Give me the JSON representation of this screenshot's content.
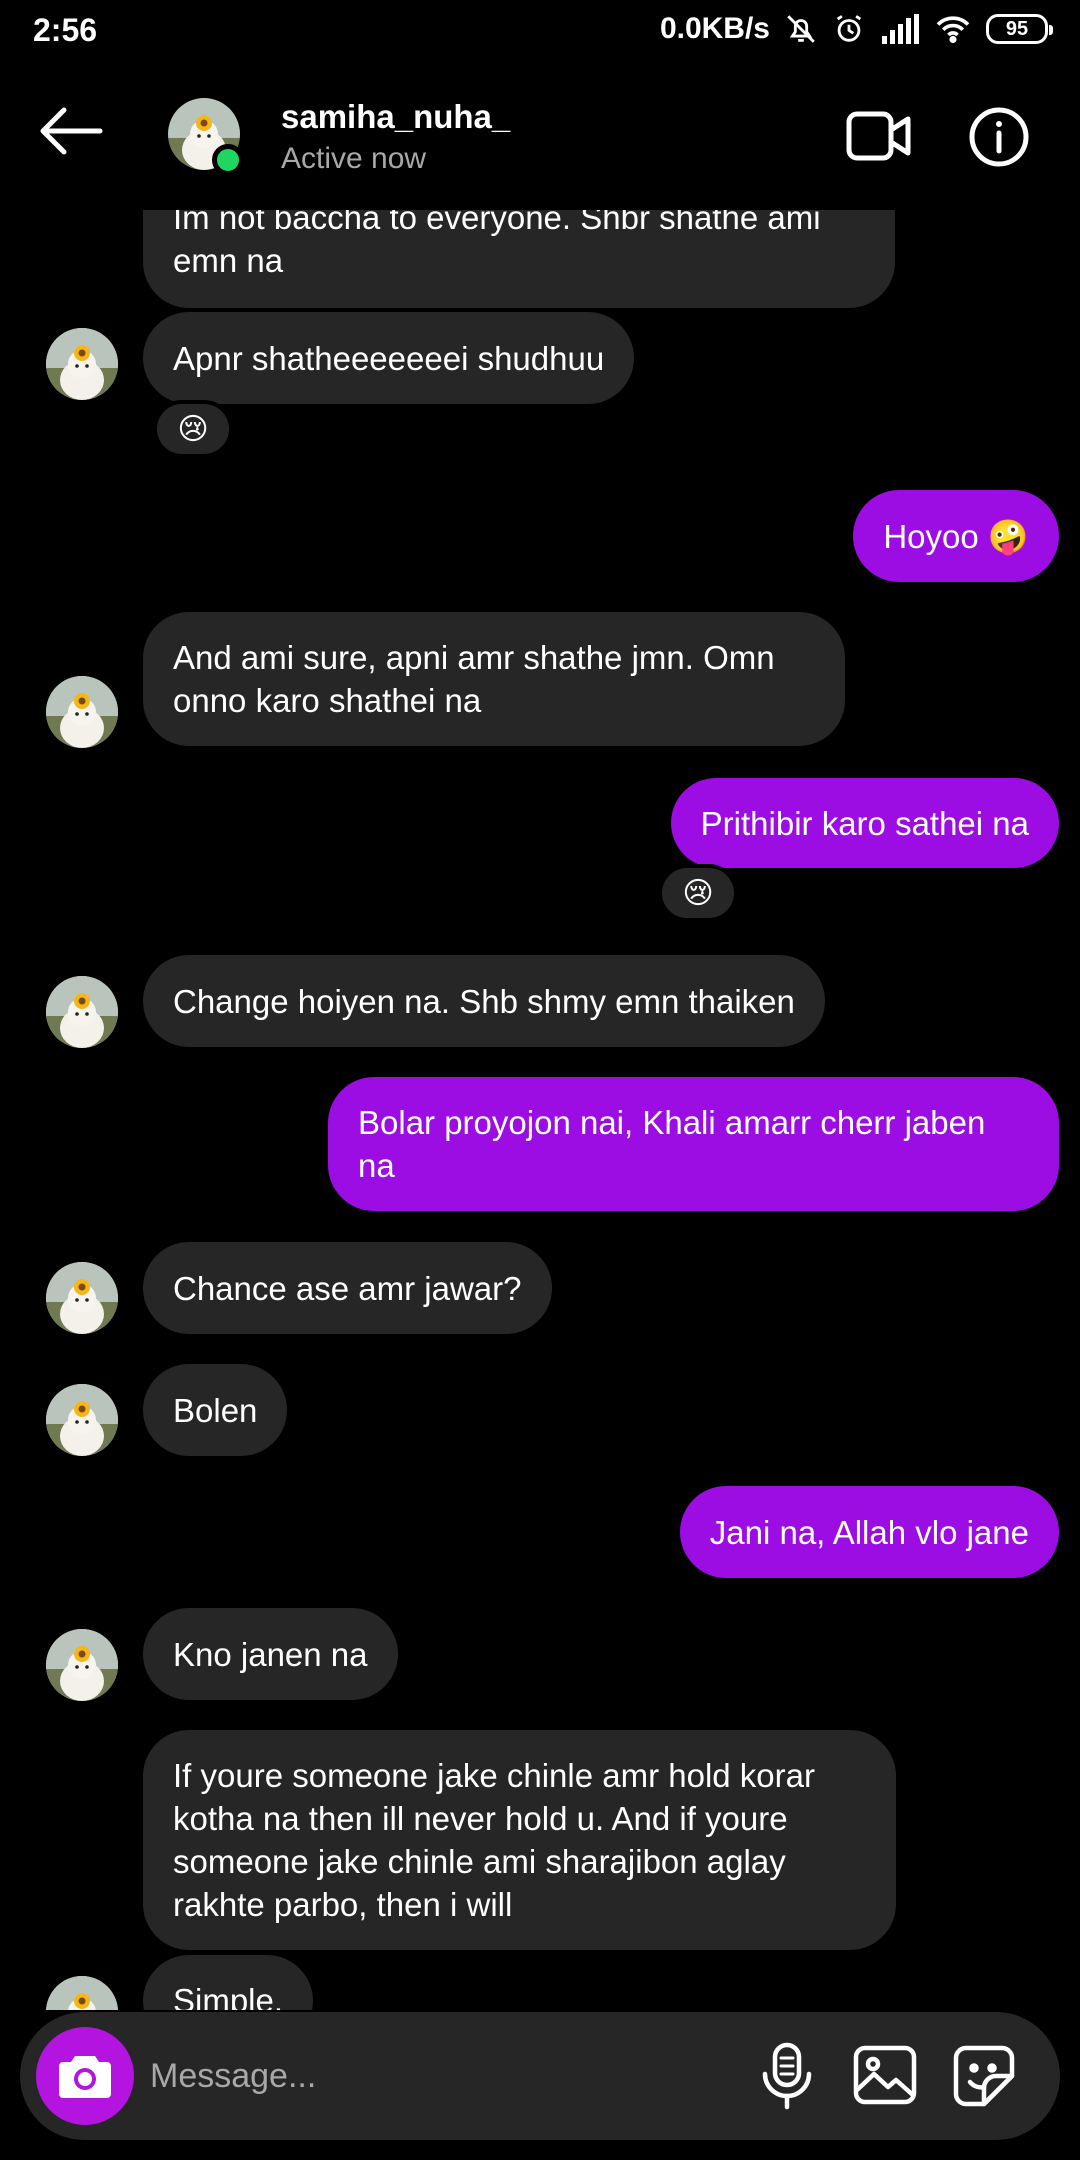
{
  "status_bar": {
    "time": "2:56",
    "network_speed": "0.0KB/s",
    "battery": "95",
    "icons": [
      "mute-icon",
      "alarm-icon",
      "signal-icon",
      "wifi-icon",
      "battery-icon"
    ]
  },
  "header": {
    "contact_name": "samiha_nuha_",
    "contact_status": "Active now",
    "online_color": "#1ed760"
  },
  "messages": [
    {
      "sender": "them",
      "lines": [
        "Im not baccha to everyone. Shbr shathe ami",
        "emn na"
      ]
    },
    {
      "sender": "them",
      "text": "Apnr shatheeeeeeei shudhuu",
      "reaction": "😢"
    },
    {
      "sender": "me",
      "text": "Hoyoo 🤪"
    },
    {
      "sender": "them",
      "lines": [
        "And ami sure, apni amr shathe jmn. Omn",
        "onno karo shathei na"
      ]
    },
    {
      "sender": "me",
      "text": "Prithibir karo sathei na",
      "reaction": "😢"
    },
    {
      "sender": "them",
      "text": "Change hoiyen na. Shb shmy emn thaiken"
    },
    {
      "sender": "me",
      "lines": [
        "Bolar proyojon nai, Khali amarr cherr jaben",
        "na"
      ]
    },
    {
      "sender": "them",
      "text": "Chance ase amr jawar?"
    },
    {
      "sender": "them",
      "text": "Bolen"
    },
    {
      "sender": "me",
      "text": "Jani na, Allah vlo jane"
    },
    {
      "sender": "them",
      "text": "Kno janen na"
    },
    {
      "sender": "them",
      "lines": [
        "If youre someone jake chinle amr hold korar",
        "kotha na then ill never hold u. And if youre",
        "someone jake chinle ami sharajibon aglay",
        "rakhte parbo, then i will"
      ]
    },
    {
      "sender": "them",
      "text": "Simple."
    }
  ],
  "composer": {
    "placeholder": "Message..."
  },
  "colors": {
    "outgoing_bubble": "#9b0de3",
    "incoming_bubble": "#262626",
    "camera_button": "#b314e0"
  }
}
